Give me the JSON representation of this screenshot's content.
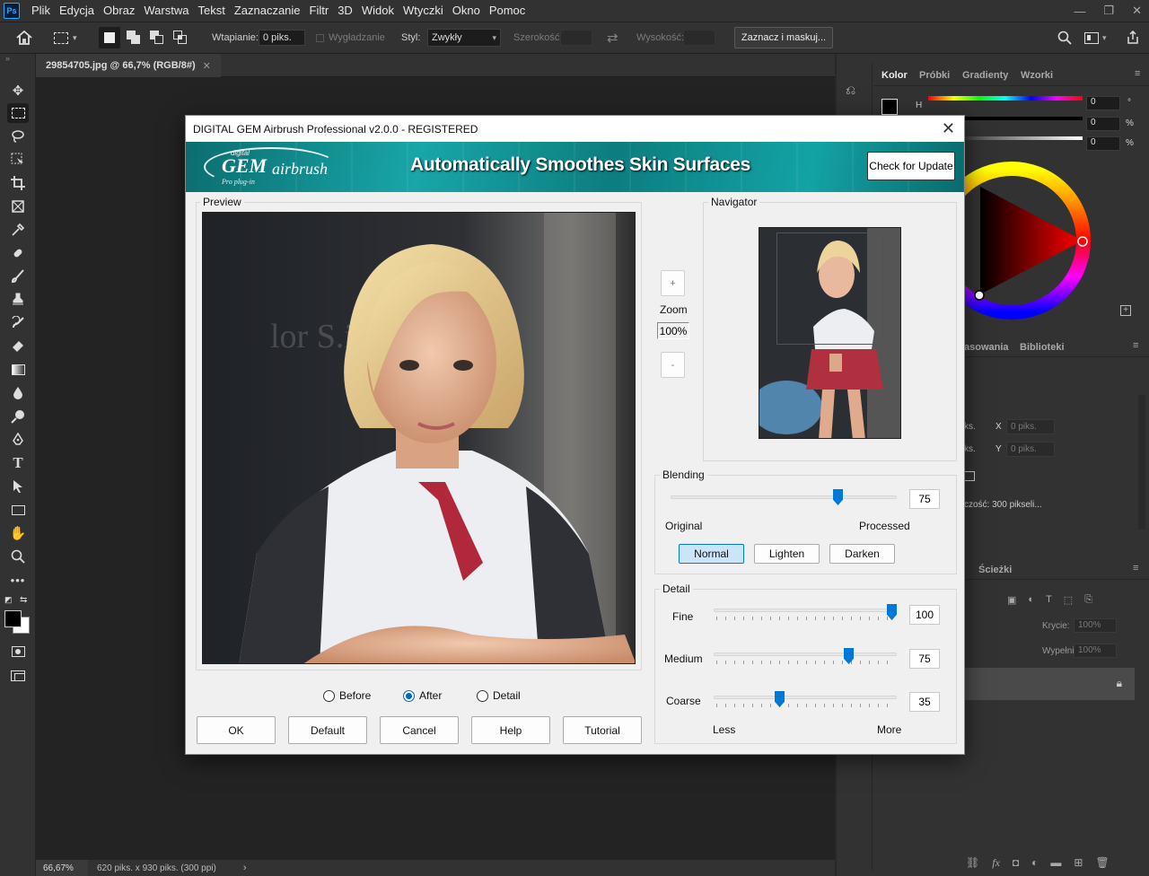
{
  "app": {
    "logo": "Ps",
    "menu": [
      "Plik",
      "Edycja",
      "Obraz",
      "Warstwa",
      "Tekst",
      "Zaznaczanie",
      "Filtr",
      "3D",
      "Widok",
      "Wtyczki",
      "Okno",
      "Pomoc"
    ]
  },
  "options_bar": {
    "feather_label": "Wtapianie:",
    "feather_value": "0 piks.",
    "antialias_label": "Wygładzanie",
    "style_label": "Styl:",
    "style_value": "Zwykły",
    "width_label": "Szerokość:",
    "height_label": "Wysokość:",
    "select_mask_button": "Zaznacz i maskuj..."
  },
  "document": {
    "tab_label": "29854705.jpg @ 66,7% (RGB/8#)",
    "zoom": "66,67%",
    "size_info": "620 piks. x 930 piks. (300 ppi)"
  },
  "panels": {
    "color_tabs": [
      "Kolor",
      "Próbki",
      "Gradienty",
      "Wzorki"
    ],
    "h_label": "H",
    "h_value": "0",
    "h_unit": "°",
    "s_value": "0",
    "s_unit": "%",
    "b_value": "0",
    "b_unit": "%",
    "mid_tabs": [
      "asowania",
      "Biblioteki"
    ],
    "props_x_label": "X",
    "props_y_label": "Y",
    "props_x_value": "0 piks.",
    "props_y_value": "0 piks.",
    "props_w_suffix": "ks.",
    "props_h_suffix": "ks.",
    "resolution_text": "czość:  300  pikseli...",
    "layers_tab": "Ścieżki",
    "opacity_label": "Krycie:",
    "opacity_value": "100%",
    "fill_label": "Wypełnienie:",
    "fill_value": "100%"
  },
  "dialog": {
    "title": "DIGITAL GEM Airbrush Professional v2.0.0 - REGISTERED",
    "banner": {
      "logo_top": "digital",
      "logo_main": "GEM",
      "logo_sub": "airbrush",
      "logo_small": "Pro plug-in",
      "slogan": "Automatically Smoothes Skin Surfaces"
    },
    "check_update": "Check for Update",
    "preview_label": "Preview",
    "navigator_label": "Navigator",
    "zoom_plus": "+",
    "zoom_label": "Zoom",
    "zoom_value": "100%",
    "zoom_minus": "-",
    "blending": {
      "label": "Blending",
      "value": "75",
      "fraction": 0.75,
      "left_label": "Original",
      "right_label": "Processed",
      "modes": [
        "Normal",
        "Lighten",
        "Darken"
      ],
      "selected_mode": "Normal"
    },
    "detail": {
      "label": "Detail",
      "sliders": [
        {
          "name": "Fine",
          "value": "100",
          "fraction": 1.0
        },
        {
          "name": "Medium",
          "value": "75",
          "fraction": 0.75
        },
        {
          "name": "Coarse",
          "value": "35",
          "fraction": 0.35
        }
      ],
      "less_label": "Less",
      "more_label": "More"
    },
    "view_options": [
      "Before",
      "After",
      "Detail"
    ],
    "view_selected": "After",
    "buttons": [
      "OK",
      "Default",
      "Cancel",
      "Help",
      "Tutorial"
    ]
  }
}
